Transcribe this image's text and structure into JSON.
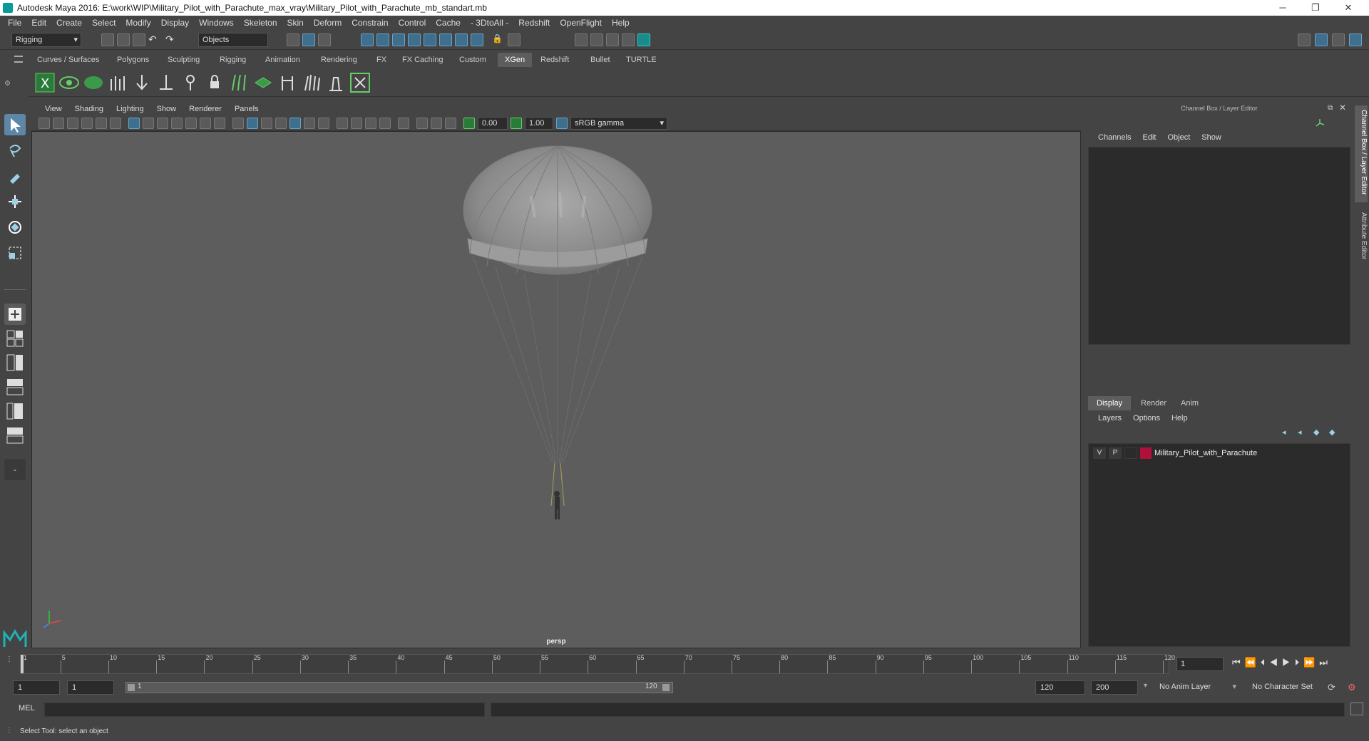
{
  "window": {
    "title": "Autodesk Maya 2016: E:\\work\\WIP\\Military_Pilot_with_Parachute_max_vray\\Military_Pilot_with_Parachute_mb_standart.mb",
    "minimize": "─",
    "restore": "❐",
    "close": "✕"
  },
  "menubar": [
    "File",
    "Edit",
    "Create",
    "Select",
    "Modify",
    "Display",
    "Windows",
    "Skeleton",
    "Skin",
    "Deform",
    "Constrain",
    "Control",
    "Cache",
    "- 3DtoAll -",
    "Redshift",
    "OpenFlight",
    "Help"
  ],
  "status": {
    "menuset": "Rigging",
    "selection_mode": "Objects"
  },
  "shelf_tabs": [
    "Curves / Surfaces",
    "Polygons",
    "Sculpting",
    "Rigging",
    "Animation",
    "Rendering",
    "FX",
    "FX Caching",
    "Custom",
    "XGen",
    "Redshift",
    "Bullet",
    "TURTLE"
  ],
  "shelf_active": "XGen",
  "panel_menu": [
    "View",
    "Shading",
    "Lighting",
    "Show",
    "Renderer",
    "Panels"
  ],
  "panel_toolbar": {
    "exposure": "0.00",
    "gamma": "1.00",
    "color_space": "sRGB gamma"
  },
  "viewport": {
    "camera": "persp"
  },
  "channel_box": {
    "title": "Channel Box / Layer Editor",
    "menu": [
      "Channels",
      "Edit",
      "Object",
      "Show"
    ]
  },
  "layer_editor": {
    "tabs": [
      "Display",
      "Render",
      "Anim"
    ],
    "active_tab": "Display",
    "menu": [
      "Layers",
      "Options",
      "Help"
    ],
    "layers": [
      {
        "v": "V",
        "p": "P",
        "color": "#b0103a",
        "name": "Military_Pilot_with_Parachute"
      }
    ]
  },
  "side_tabs": [
    "Channel Box / Layer Editor",
    "Attribute Editor"
  ],
  "timeline": {
    "ticks": [
      "1",
      "5",
      "10",
      "15",
      "20",
      "25",
      "30",
      "35",
      "40",
      "45",
      "50",
      "55",
      "60",
      "65",
      "70",
      "75",
      "80",
      "85",
      "90",
      "95",
      "100",
      "105",
      "110",
      "115",
      "120"
    ],
    "current_frame": "1"
  },
  "range": {
    "start": "1",
    "playback_start": "1",
    "slider_start": "1",
    "slider_end": "120",
    "playback_end": "120",
    "end": "200",
    "anim_layer": "No Anim Layer",
    "character_set": "No Character Set"
  },
  "command": {
    "label": "MEL"
  },
  "help": {
    "text": "Select Tool: select an object"
  }
}
